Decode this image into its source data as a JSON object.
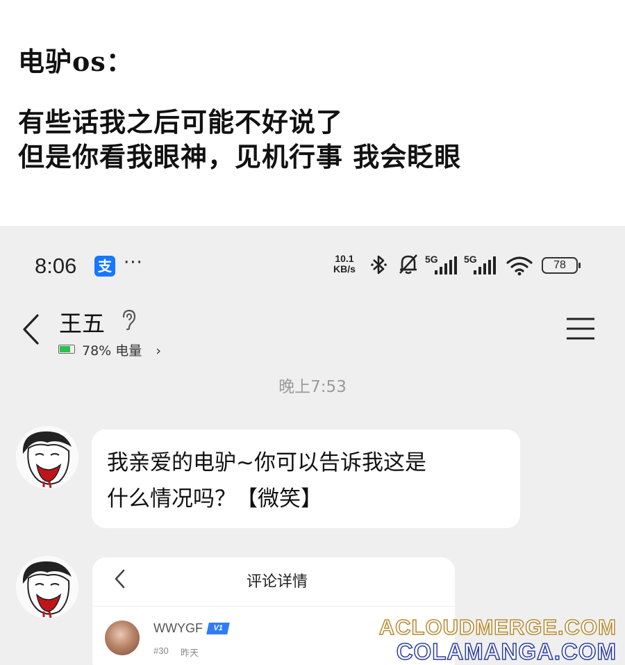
{
  "caption": {
    "line1": "电驴os：",
    "line2": "有些话我之后可能不好说了",
    "line3": "但是你看我眼神，见机行事  我会眨眼"
  },
  "status_bar": {
    "time": "8:06",
    "app_badge": "支",
    "more": "···",
    "net_speed_value": "10.1",
    "net_speed_unit": "KB/s",
    "signal1_label": "5G",
    "signal2_label": "5G",
    "battery": "78",
    "icons": [
      "bluetooth-icon",
      "mute-bell-icon",
      "signal-icon",
      "wifi-icon",
      "battery-icon"
    ]
  },
  "header": {
    "contact_name": "王五",
    "battery_text": "78% 电量",
    "battery_chevron": "›",
    "battery_level": 0.78
  },
  "timestamp": "晚上7:53",
  "messages": [
    {
      "type": "text",
      "lines": [
        "我亲爱的电驴~你可以告诉我这是",
        "什么情况吗？【微笑】"
      ]
    },
    {
      "type": "shared-card",
      "title": "评论详情",
      "user": "WWYGF",
      "badge": "V1",
      "floor": "#30",
      "date": "昨天"
    }
  ],
  "watermark": {
    "line1": "ACLOUDMERGE.COM",
    "line2": "COLAMANGA.COM"
  },
  "colors": {
    "alipay": "#1677ff",
    "battery_green": "#2fbf4a",
    "chat_bg": "#efefef",
    "badge_blue": "#2f7df6"
  }
}
